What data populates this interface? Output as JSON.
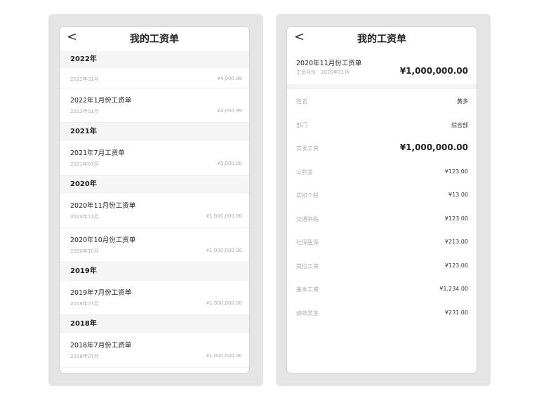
{
  "left": {
    "title": "我的工资单",
    "groups": [
      {
        "year": "2022年",
        "items": [
          {
            "name": "",
            "date": "2022年01月",
            "amount": "¥4,000.99"
          },
          {
            "name": "2022年1月份工资单",
            "date": "2022年01月",
            "amount": "¥4,000.99"
          }
        ]
      },
      {
        "year": "2021年",
        "items": [
          {
            "name": "2021年7月工资单",
            "date": "2021年07月",
            "amount": "¥5,000.00"
          }
        ]
      },
      {
        "year": "2020年",
        "items": [
          {
            "name": "2020年11月份工资单",
            "date": "2020年11月",
            "amount": "¥1,000,000.00"
          },
          {
            "name": "2020年10月份工资单",
            "date": "2020年10月",
            "amount": "¥1,000,000.00"
          }
        ]
      },
      {
        "year": "2019年",
        "items": [
          {
            "name": "2019年7月份工资单",
            "date": "2019年07月",
            "amount": "¥1,000,000.00"
          }
        ]
      },
      {
        "year": "2018年",
        "items": [
          {
            "name": "2018年7月份工资单",
            "date": "2018年07月",
            "amount": "¥1,000,000.00"
          }
        ]
      }
    ]
  },
  "right": {
    "title": "我的工资单",
    "header": {
      "name": "2020年11月份工资单",
      "month": "工资月份：2020年11月",
      "total": "¥1,000,000.00"
    },
    "rows": [
      {
        "label": "姓名",
        "value": "黄多",
        "emph": false
      },
      {
        "label": "部门",
        "value": "综合部",
        "emph": false
      },
      {
        "label": "实发工资",
        "value": "¥1,000,000.00",
        "emph": true
      },
      {
        "label": "公积金",
        "value": "¥123.00",
        "emph": false
      },
      {
        "label": "实扣个税",
        "value": "¥13.00",
        "emph": false
      },
      {
        "label": "交通补贴",
        "value": "¥123.00",
        "emph": false
      },
      {
        "label": "社保医保",
        "value": "¥213.00",
        "emph": false
      },
      {
        "label": "岗位工资",
        "value": "¥123.00",
        "emph": false
      },
      {
        "label": "基本工资",
        "value": "¥1,234.00",
        "emph": false
      },
      {
        "label": "绩效奖金",
        "value": "¥231.00",
        "emph": false
      }
    ]
  },
  "icons": {
    "back": "chevron-left-icon"
  }
}
